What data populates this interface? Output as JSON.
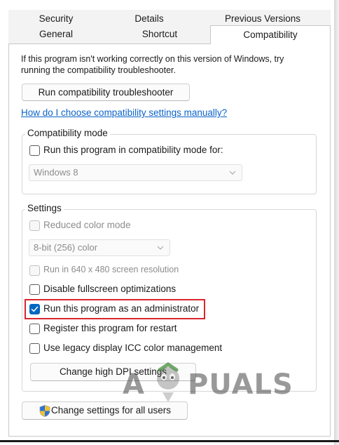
{
  "tabs": {
    "top_row": [
      "Security",
      "Details",
      "Previous Versions"
    ],
    "bottom_row": [
      "General",
      "Shortcut",
      "Compatibility"
    ],
    "active": "Compatibility"
  },
  "intro": {
    "line1": "If this program isn't working correctly on this version of Windows, try",
    "line2": "running the compatibility troubleshooter."
  },
  "buttons": {
    "troubleshooter": "Run compatibility troubleshooter",
    "dpi": "Change high DPI settings",
    "all_users": "Change settings for all users"
  },
  "link": {
    "manual": "How do I choose compatibility settings manually?"
  },
  "compat_mode": {
    "group_label": "Compatibility mode",
    "checkbox_label": "Run this program in compatibility mode for:",
    "checked": false,
    "os_select_value": "Windows 8"
  },
  "settings": {
    "group_label": "Settings",
    "reduced_color": {
      "label": "Reduced color mode",
      "checked": false,
      "enabled": false
    },
    "color_select_value": "8-bit (256) color",
    "res_640": {
      "label": "Run in 640 x 480 screen resolution",
      "checked": false,
      "enabled": false
    },
    "fullscreen": {
      "label": "Disable fullscreen optimizations",
      "checked": false,
      "enabled": true
    },
    "admin": {
      "label": "Run this program as an administrator",
      "checked": true,
      "enabled": true
    },
    "restart": {
      "label": "Register this program for restart",
      "checked": false,
      "enabled": true
    },
    "icc": {
      "label": "Use legacy display ICC color management",
      "checked": false,
      "enabled": true
    }
  },
  "watermark": {
    "text_a": "A",
    "text_rest": "PUALS"
  },
  "colors": {
    "accent": "#0067c0",
    "link": "#0b63c9",
    "highlight": "#d9262e",
    "disabled_text": "#8c8c8c"
  },
  "icons": {
    "checkmark": "checkmark-icon",
    "chevron": "chevron-down-icon",
    "shield": "uac-shield-icon"
  }
}
